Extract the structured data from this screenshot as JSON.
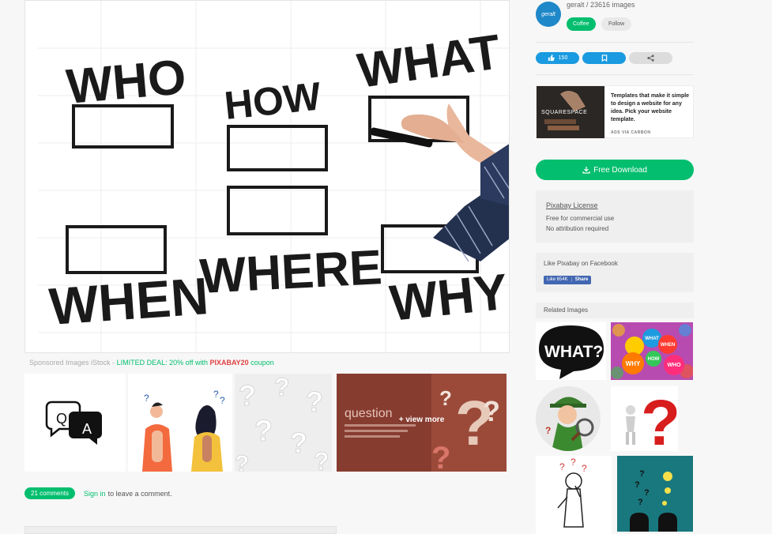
{
  "main_image": {
    "words": [
      "WHO",
      "HOW",
      "WHAT",
      "WHEN",
      "WHERE",
      "WHY"
    ]
  },
  "sponsored": {
    "prefix": "Sponsored Images iStock -",
    "deal": "LIMITED DEAL: 20% off with",
    "code": "PIXABAY20",
    "suffix": "coupon"
  },
  "thumbs": {
    "qa_icon_text_q": "Q",
    "qa_icon_text_a": "A",
    "view_more_bg_text": "question",
    "view_more_label": "+ view more"
  },
  "comments": {
    "count_label": "21 comments",
    "signin_label": "Sign in",
    "note": "to leave a comment."
  },
  "author": {
    "avatar_text": "geralt",
    "name": "geralt / 23616 images",
    "coffee_label": "Coffee",
    "follow_label": "Follow"
  },
  "actions": {
    "like_count": "150"
  },
  "ad": {
    "brand": "SQUARESPACE",
    "text": "Templates that make it simple to design a website for any idea. Pick your website template.",
    "via": "ADS VIA CARBON"
  },
  "download": {
    "label": "Free Download"
  },
  "license": {
    "link": "Pixabay License",
    "line1": "Free for commercial use",
    "line2": "No attribution required"
  },
  "facebook": {
    "title": "Like Pixabay on Facebook",
    "like_label": "Like 654K",
    "share_label": "Share"
  },
  "related": {
    "title": "Related Images",
    "what_text": "WHAT?",
    "bubbles": [
      "WHAT",
      "WHEN",
      "WHY",
      "HOW",
      "WHO"
    ]
  },
  "colors": {
    "green": "#02be6e",
    "blue": "#1a9ae0",
    "fb": "#4267b2"
  }
}
